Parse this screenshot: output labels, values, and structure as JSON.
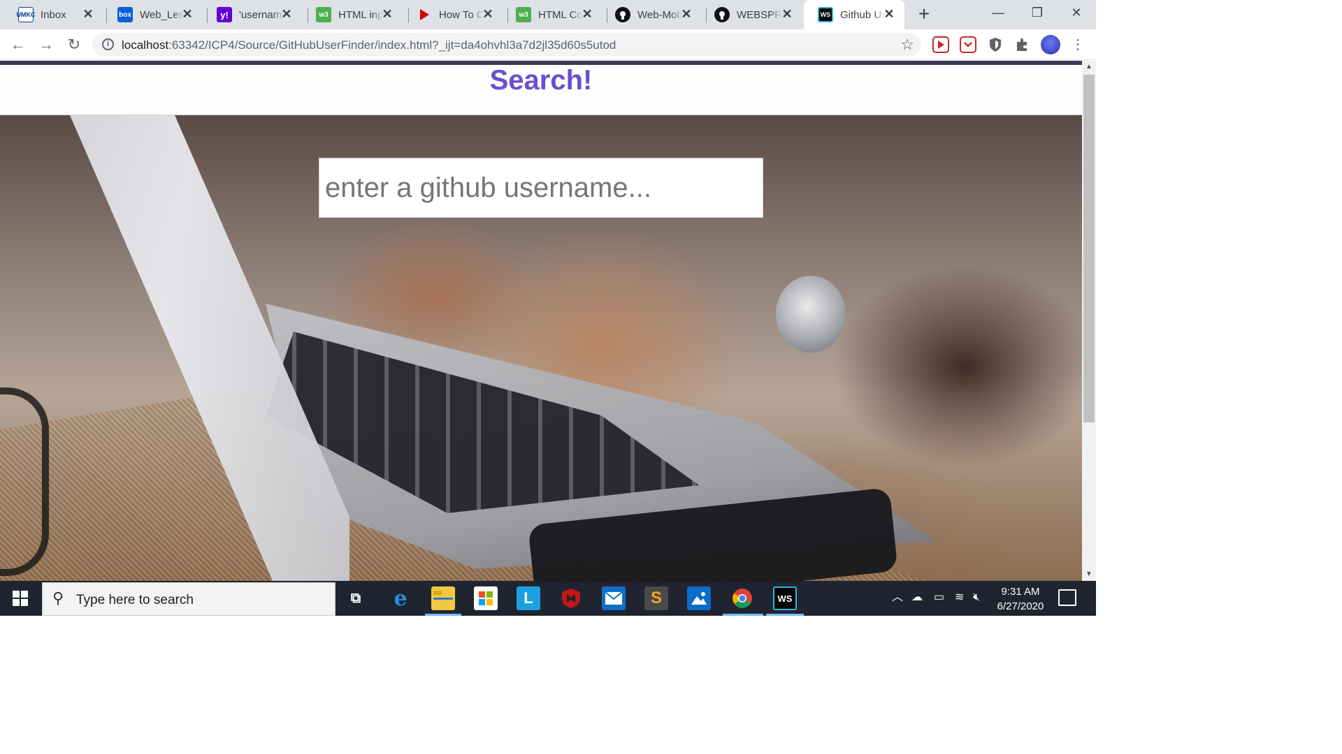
{
  "browser": {
    "tabs": [
      {
        "title": "Inbox",
        "favicon": "umkc-icon",
        "color": "#003f87"
      },
      {
        "title": "Web_Less",
        "favicon": "box-icon",
        "color": "#0061d5"
      },
      {
        "title": "'username",
        "favicon": "yahoo-icon",
        "color": "#6001d2"
      },
      {
        "title": "HTML inp",
        "favicon": "w3schools-icon",
        "color": "#4caf50"
      },
      {
        "title": "How To C",
        "favicon": "play-icon",
        "color": "#d00000"
      },
      {
        "title": "HTML Col",
        "favicon": "w3schools-icon",
        "color": "#4caf50"
      },
      {
        "title": "Web-Mob",
        "favicon": "github-icon",
        "color": "#111111"
      },
      {
        "title": "WEBSPRI",
        "favicon": "github-icon",
        "color": "#111111"
      },
      {
        "title": "Github Us",
        "favicon": "webstorm-icon",
        "color": "#000000"
      }
    ],
    "active_tab_index": 8,
    "url_host": "localhost",
    "url_rest": ":63342/ICP4/Source/GitHubUserFinder/index.html?_ijt=da4ohvhl3a7d2jl35d60s5utod"
  },
  "page": {
    "heading": "Search!",
    "search_placeholder": "enter a github username...",
    "heading_color": "#6a4fcf"
  },
  "taskbar": {
    "search_placeholder": "Type here to search",
    "time": "9:31 AM",
    "date": "6/27/2020",
    "apps": [
      "task-view-icon",
      "edge-icon",
      "file-explorer-icon",
      "store-icon",
      "l-app-icon",
      "mcafee-icon",
      "mail-icon",
      "sublime-icon",
      "photos-icon",
      "chrome-icon",
      "webstorm-icon"
    ]
  }
}
